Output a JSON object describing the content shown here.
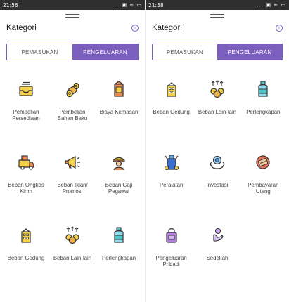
{
  "left": {
    "status": {
      "time": "21:56",
      "icons": "... ▣ ≋ ▭"
    },
    "title": "Kategori",
    "tabs": {
      "income": "PEMASUKAN",
      "expense": "PENGELUARAN"
    },
    "categories": [
      {
        "label": "Pembelian Persediaan",
        "icon": "tray-icon"
      },
      {
        "label": "Pembelian Bahan Baku",
        "icon": "logs-icon"
      },
      {
        "label": "Biaya Kemasan",
        "icon": "package-icon"
      },
      {
        "label": "Beban Ongkos Kirim",
        "icon": "delivery-icon"
      },
      {
        "label": "Beban Iklan/ Promosi",
        "icon": "megaphone-icon"
      },
      {
        "label": "Beban Gaji Pegawai",
        "icon": "worker-icon"
      },
      {
        "label": "Beban Gedung",
        "icon": "building-icon"
      },
      {
        "label": "Beban Lain-lain",
        "icon": "coins-icon"
      },
      {
        "label": "Perlengkapan",
        "icon": "bottle-icon"
      }
    ]
  },
  "right": {
    "status": {
      "time": "21:58",
      "icons": "... ▣ ≋ ▭"
    },
    "title": "Kategori",
    "tabs": {
      "income": "PEMASUKAN",
      "expense": "PENGELUARAN"
    },
    "categories": [
      {
        "label": "Beban Gedung",
        "icon": "building-icon"
      },
      {
        "label": "Beban Lain-lain",
        "icon": "coins-icon"
      },
      {
        "label": "Perlengkapan",
        "icon": "bottle-icon"
      },
      {
        "label": "Peralatan",
        "icon": "tools-icon"
      },
      {
        "label": "Investasi",
        "icon": "investment-icon"
      },
      {
        "label": "Pembayaran Utang",
        "icon": "debt-icon"
      },
      {
        "label": "Pengeluaran Pribadi",
        "icon": "personal-icon"
      },
      {
        "label": "Sedekah",
        "icon": "charity-icon"
      }
    ]
  },
  "colors": {
    "accent": "#7a5fbf",
    "icon_yellow": "#f5d04a",
    "icon_stroke": "#333333"
  }
}
